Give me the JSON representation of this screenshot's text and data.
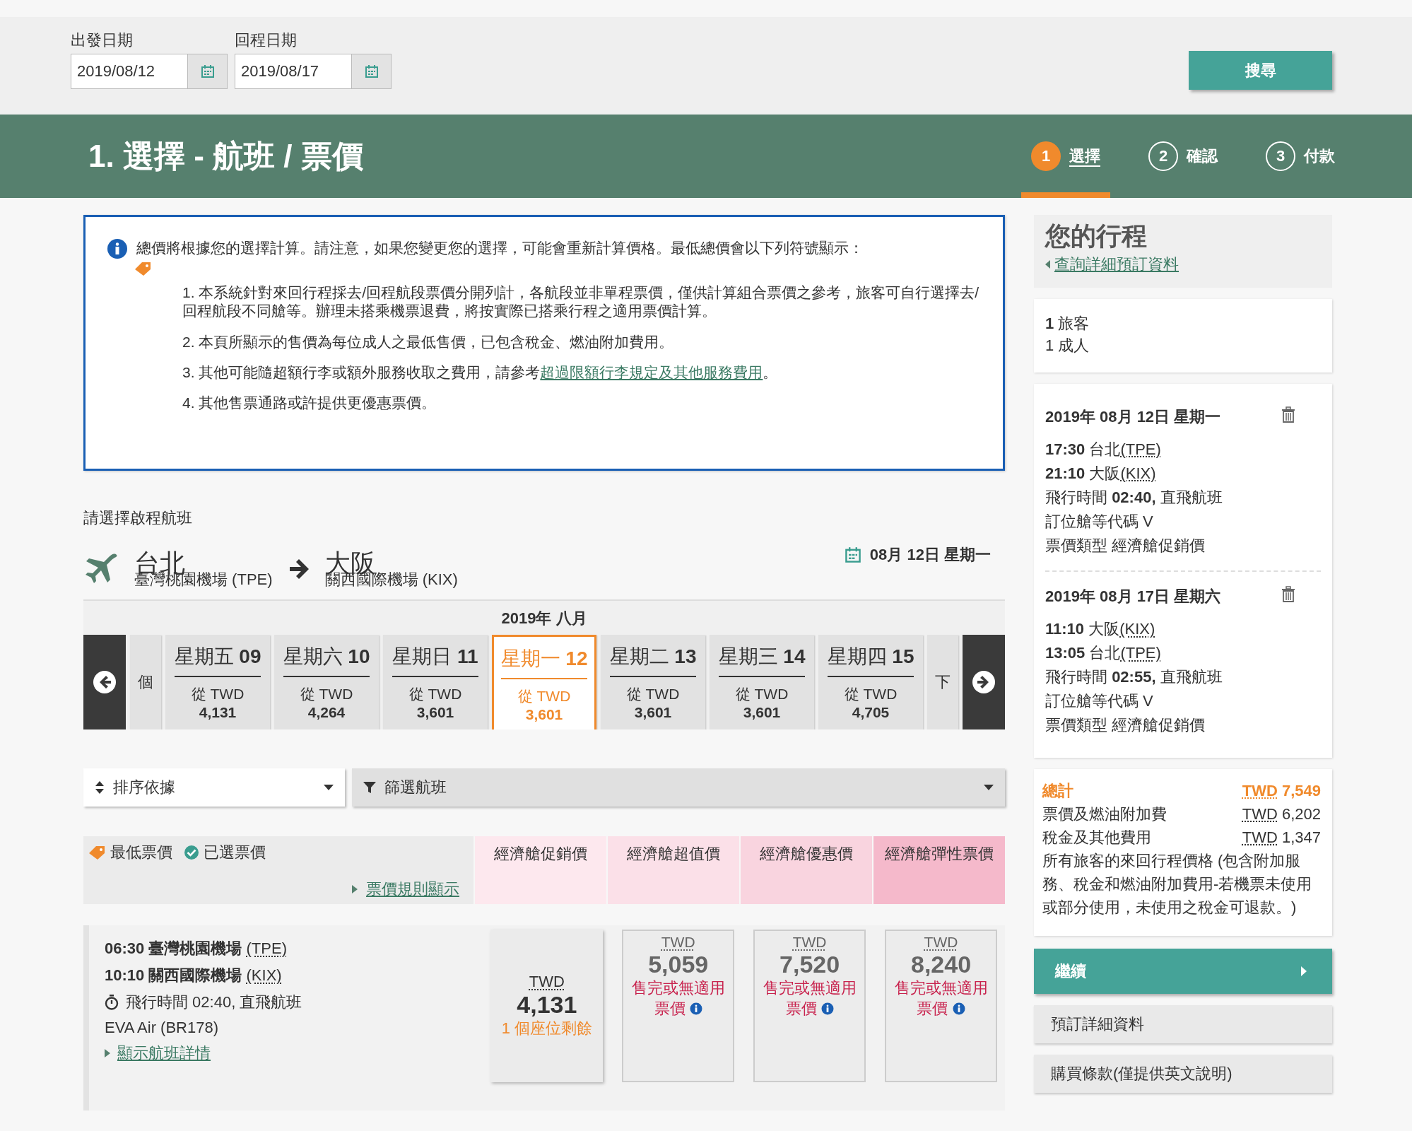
{
  "search_bar": {
    "fields": [
      {
        "label": "出發日期",
        "value": "2019/08/12"
      },
      {
        "label": "回程日期",
        "value": "2019/08/17"
      }
    ],
    "search_button": "搜尋"
  },
  "header": {
    "title": "1. 選擇 - 航班 / 票價",
    "steps": [
      {
        "number": "1",
        "label": "選擇",
        "selected": true
      },
      {
        "number": "2",
        "label": "確認",
        "selected": false
      },
      {
        "number": "3",
        "label": "付款",
        "selected": false
      }
    ]
  },
  "notice": {
    "text": "總價將根據您的選擇計算。請注意，如果您變更您的選擇，可能會重新計算價格。最低總價會以下列符號顯示：",
    "items": [
      {
        "text": "1. 本系統針對來回行程採去/回程航段票價分開列計，各航段並非單程票價，僅供計算組合票價之參考，旅客可自行選擇去/回程航段不同艙等。辦理未搭乘機票退費，將按實際已搭乘行程之適用票價計算。"
      },
      {
        "text": "2. 本頁所顯示的售價為每位成人之最低售價，已包含稅金、燃油附加費用。"
      },
      {
        "text": "3. 其他可能隨超額行李或額外服務收取之費用，請參考",
        "link": "超過限額行李規定及其他服務費用",
        "after": "。"
      },
      {
        "text": "4. 其他售票通路或許提供更優惠票價。"
      }
    ]
  },
  "outbound": {
    "heading": "請選擇啟程航班",
    "origin": {
      "city": "台北",
      "airport": "臺灣桃園機場 (TPE)"
    },
    "destination": {
      "city": "大阪",
      "airport": "關西國際機場 (KIX)"
    },
    "date": "08月 12日 星期一",
    "calendar": {
      "month": "2019年 八月",
      "days": [
        {
          "kind": "partial",
          "text": "個"
        },
        {
          "kind": "day",
          "weekday": "星期五",
          "date": "09",
          "from": "從 TWD",
          "price": "4,131",
          "selected": false
        },
        {
          "kind": "day",
          "weekday": "星期六",
          "date": "10",
          "from": "從 TWD",
          "price": "4,264",
          "selected": false
        },
        {
          "kind": "day",
          "weekday": "星期日",
          "date": "11",
          "from": "從 TWD",
          "price": "3,601",
          "selected": false
        },
        {
          "kind": "day",
          "weekday": "星期一",
          "date": "12",
          "from": "從 TWD",
          "price": "3,601",
          "selected": true
        },
        {
          "kind": "day",
          "weekday": "星期二",
          "date": "13",
          "from": "從 TWD",
          "price": "3,601",
          "selected": false
        },
        {
          "kind": "day",
          "weekday": "星期三",
          "date": "14",
          "from": "從 TWD",
          "price": "3,601",
          "selected": false
        },
        {
          "kind": "day",
          "weekday": "星期四",
          "date": "15",
          "from": "從 TWD",
          "price": "4,705",
          "selected": false
        },
        {
          "kind": "partial",
          "text": "下"
        }
      ]
    },
    "sort": "排序依據",
    "filter": "篩選航班",
    "legend": {
      "lowest": "最低票價",
      "selected": "已選票價",
      "rules_link": "票價規則顯示"
    },
    "fare_columns": [
      {
        "label": "經濟艙促銷價",
        "color": "#fde8ee"
      },
      {
        "label": "經濟艙超值價",
        "color": "#fbe0e8"
      },
      {
        "label": "經濟艙優惠價",
        "color": "#f9d4df"
      },
      {
        "label": "經濟艙彈性票價",
        "color": "#f5b9cb"
      }
    ],
    "flights": [
      {
        "departure": {
          "time": "06:30",
          "airport": "臺灣桃園機場",
          "code": "(TPE)"
        },
        "arrival": {
          "time": "10:10",
          "airport": "關西國際機場",
          "code": "(KIX)"
        },
        "duration": "飛行時間 02:40, 直飛航班",
        "airline": "EVA Air (BR178)",
        "details_link": "顯示航班詳情",
        "fares": [
          {
            "kind": "available",
            "currency": "TWD",
            "price": "4,131",
            "note": "1 個座位剩餘"
          },
          {
            "kind": "sold_out",
            "currency": "TWD",
            "price": "5,059",
            "note": "售完或無適用票價"
          },
          {
            "kind": "sold_out",
            "currency": "TWD",
            "price": "7,520",
            "note": "售完或無適用票價"
          },
          {
            "kind": "sold_out",
            "currency": "TWD",
            "price": "8,240",
            "note": "售完或無適用票價"
          }
        ]
      }
    ]
  },
  "itinerary": {
    "title": "您的行程",
    "link": "查詢詳細預訂資料",
    "passengers": [
      "**1** 旅客",
      "1 成人"
    ],
    "flights": [
      {
        "date": "2019年 08月 12日 星期一",
        "departure": {
          "time": "17:30",
          "city": "台北",
          "code": "(TPE)"
        },
        "arrival": {
          "time": "21:10",
          "city": "大阪",
          "code": "(KIX)"
        },
        "duration": "飛行時間 **02:40,** 直飛航班",
        "booking_class": "訂位艙等代碼 V",
        "fare_type": "票價類型 經濟艙促銷價"
      },
      {
        "date": "2019年 08月 17日 星期六",
        "departure": {
          "time": "11:10",
          "city": "大阪",
          "code": "(KIX)"
        },
        "arrival": {
          "time": "13:05",
          "city": "台北",
          "code": "(TPE)"
        },
        "duration": "飛行時間 **02:55,** 直飛航班",
        "booking_class": "訂位艙等代碼 V",
        "fare_type": "票價類型 經濟艙促銷價"
      }
    ],
    "total": {
      "label": "總計",
      "currency": "TWD",
      "amount": "7,549",
      "lines": [
        {
          "label": "票價及燃油附加費",
          "currency": "TWD",
          "amount": "6,202"
        },
        {
          "label": "稅金及其他費用",
          "currency": "TWD",
          "amount": "1,347"
        }
      ],
      "note": "所有旅客的來回行程價格 (包含附加服務、稅金和燃油附加費用-若機票未使用或部分使用，未使用之稅金可退款。)"
    },
    "continue_button": "繼續",
    "buttons": [
      "預訂詳細資料",
      "購買條款(僅提供英文說明)"
    ]
  }
}
